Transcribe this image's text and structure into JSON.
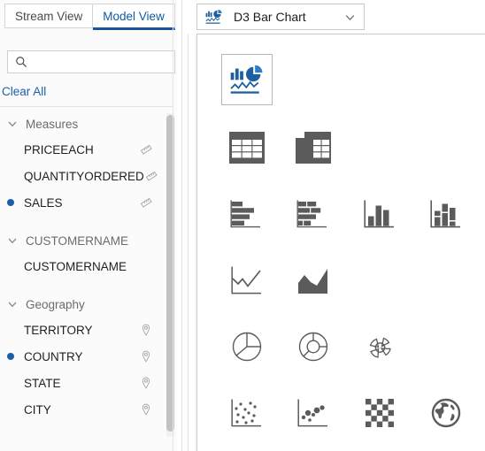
{
  "sidebar": {
    "tabs": [
      {
        "label": "Stream View",
        "active": false
      },
      {
        "label": "Model View",
        "active": true
      }
    ],
    "search": {
      "value": "",
      "placeholder": "",
      "icon": "search-icon"
    },
    "clear_all_label": "Clear All",
    "accent_color": "#1c5fa8",
    "groups": [
      {
        "name": "Measures",
        "expanded": true,
        "chevron": "chevron-down-icon",
        "items": [
          {
            "label": "PRICEEACH",
            "selected": false,
            "icon": "ruler-icon"
          },
          {
            "label": "QUANTITYORDERED",
            "selected": false,
            "icon": "ruler-icon"
          },
          {
            "label": "SALES",
            "selected": true,
            "icon": "ruler-icon"
          }
        ]
      },
      {
        "name": "CUSTOMERNAME",
        "expanded": true,
        "chevron": "chevron-down-icon",
        "items": [
          {
            "label": "CUSTOMERNAME",
            "selected": false,
            "icon": "none"
          }
        ]
      },
      {
        "name": "Geography",
        "expanded": true,
        "chevron": "chevron-down-icon",
        "items": [
          {
            "label": "TERRITORY",
            "selected": false,
            "icon": "map-pin-icon"
          },
          {
            "label": "COUNTRY",
            "selected": true,
            "icon": "map-pin-icon"
          },
          {
            "label": "STATE",
            "selected": false,
            "icon": "map-pin-icon"
          },
          {
            "label": "CITY",
            "selected": false,
            "icon": "map-pin-icon"
          }
        ]
      }
    ]
  },
  "chart_selector": {
    "selected_label": "D3 Bar Chart",
    "selected_icon": "combo-chart-icon",
    "caret_icon": "chevron-down-icon",
    "open": true,
    "options": [
      [
        {
          "name": "combo-chart-icon",
          "label": "D3 Bar Chart",
          "selected": true
        },
        {
          "name": "blank",
          "label": "",
          "selected": false
        },
        {
          "name": "blank",
          "label": "",
          "selected": false
        },
        {
          "name": "blank",
          "label": "",
          "selected": false
        }
      ],
      [
        {
          "name": "table-icon",
          "label": "Table",
          "selected": false
        },
        {
          "name": "pivot-table-icon",
          "label": "Pivot Table",
          "selected": false
        },
        {
          "name": "blank",
          "label": "",
          "selected": false
        },
        {
          "name": "blank",
          "label": "",
          "selected": false
        }
      ],
      [
        {
          "name": "horizontal-bar-chart-icon",
          "label": "Horizontal Bar Chart",
          "selected": false
        },
        {
          "name": "stacked-horizontal-bar-chart-icon",
          "label": "Stacked Horizontal Bar Chart",
          "selected": false
        },
        {
          "name": "vertical-bar-chart-icon",
          "label": "Vertical Bar Chart",
          "selected": false
        },
        {
          "name": "stacked-vertical-bar-chart-icon",
          "label": "Stacked Vertical Bar Chart",
          "selected": false
        }
      ],
      [
        {
          "name": "line-chart-icon",
          "label": "Line Chart",
          "selected": false
        },
        {
          "name": "area-chart-icon",
          "label": "Area Chart",
          "selected": false
        },
        {
          "name": "blank",
          "label": "",
          "selected": false
        },
        {
          "name": "blank",
          "label": "",
          "selected": false
        }
      ],
      [
        {
          "name": "pie-chart-icon",
          "label": "Pie Chart",
          "selected": false
        },
        {
          "name": "donut-chart-icon",
          "label": "Donut Chart",
          "selected": false
        },
        {
          "name": "exploded-pie-chart-icon",
          "label": "Exploded Pie Chart",
          "selected": false
        },
        {
          "name": "blank",
          "label": "",
          "selected": false
        }
      ],
      [
        {
          "name": "scatter-plot-icon",
          "label": "Scatter Plot",
          "selected": false
        },
        {
          "name": "bubble-chart-icon",
          "label": "Bubble Chart",
          "selected": false
        },
        {
          "name": "heatmap-icon",
          "label": "Heat Map",
          "selected": false
        },
        {
          "name": "globe-map-icon",
          "label": "Geo Map",
          "selected": false
        }
      ]
    ]
  }
}
